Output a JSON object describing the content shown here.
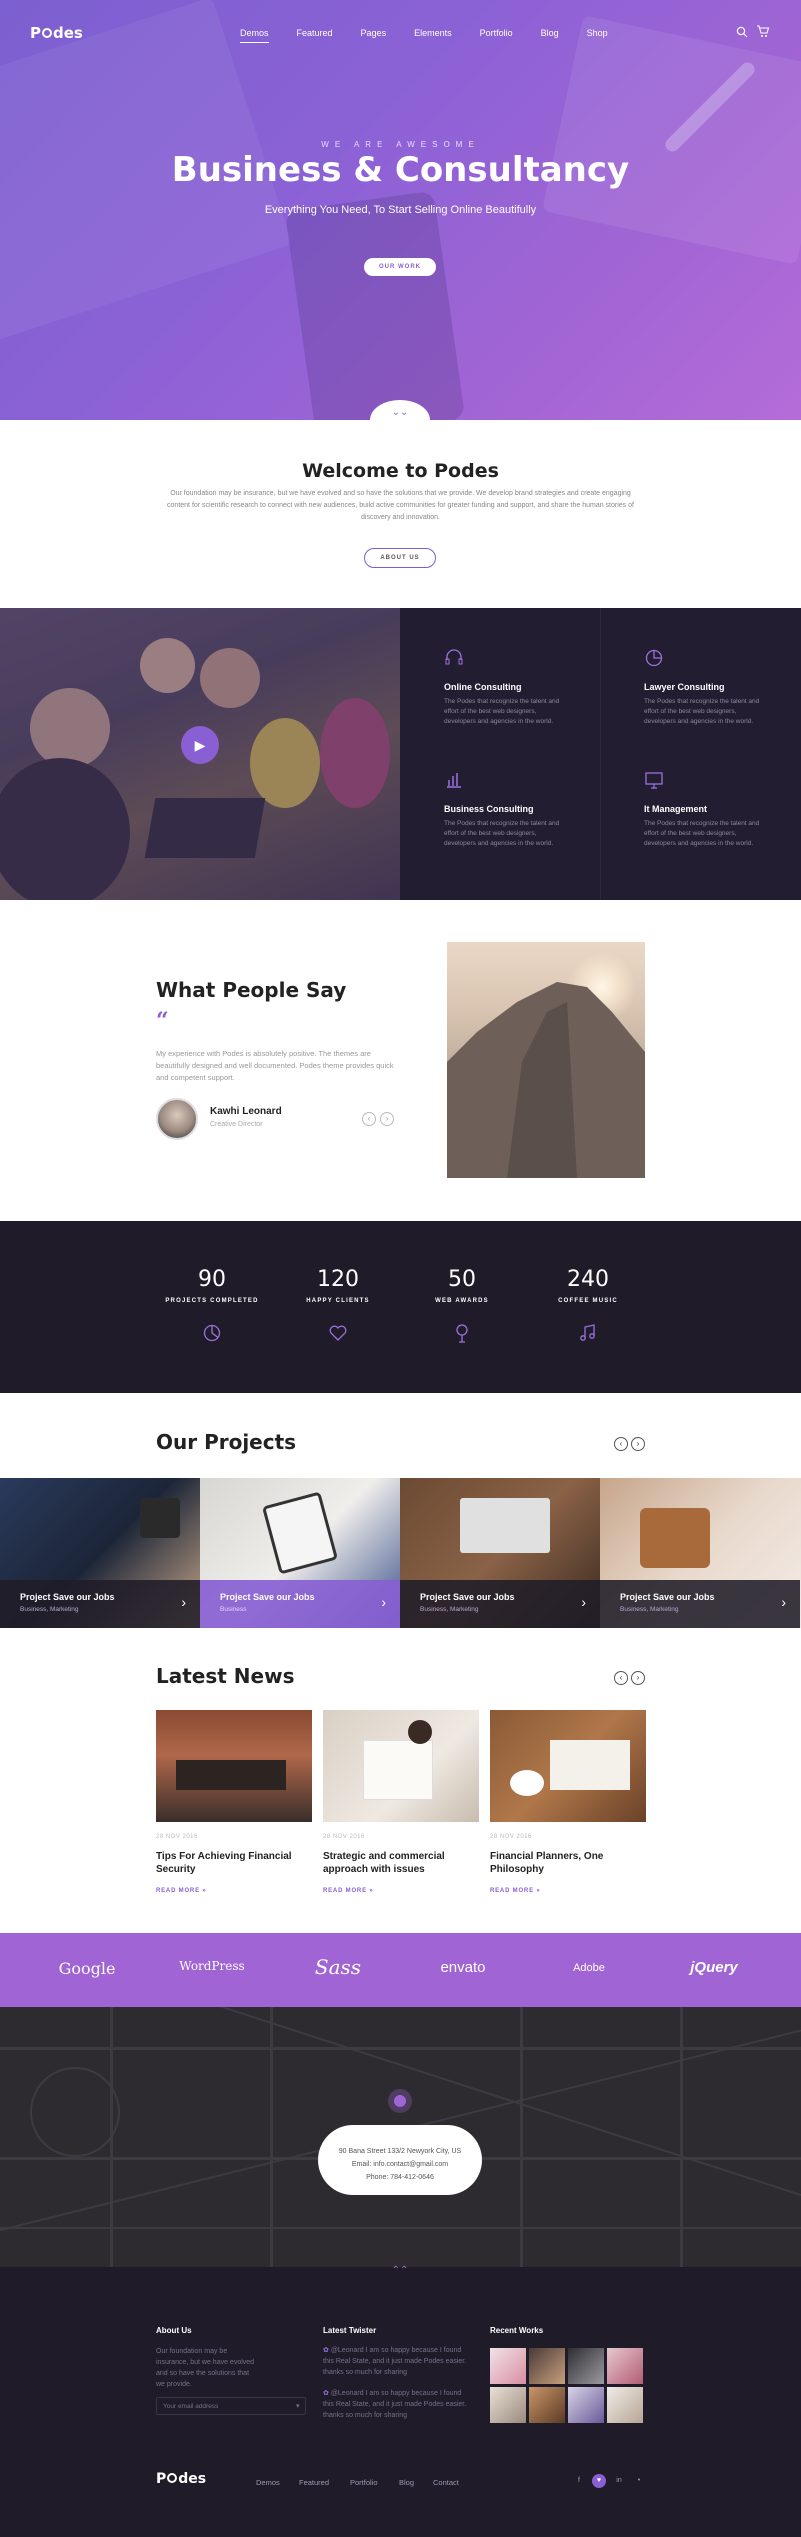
{
  "brand": {
    "logo_p": "P",
    "logo_rest": "des"
  },
  "nav": {
    "items": [
      "Demos",
      "Featured",
      "Pages",
      "Elements",
      "Portfolio",
      "Blog",
      "Shop"
    ]
  },
  "hero": {
    "pretitle": "WE ARE AWESOME",
    "title": "Business & Consultancy",
    "subtitle": "Everything You Need, To Start Selling Online Beautifully",
    "button": "OUR WORK"
  },
  "welcome": {
    "title": "Welcome to Podes",
    "text": "Our foundation may be insurance, but we have evolved and so have the solutions that we provide. We develop brand strategies and create engaging content for scientific research to connect with new audiences, build active communities for greater funding and support, and share the human stories of discovery and innovation.",
    "button": "ABOUT US"
  },
  "services": [
    {
      "icon": "headset-icon",
      "title": "Online Consulting",
      "text": "The Podes that recognize the talent and effort of the best web designers, developers and agencies in the world."
    },
    {
      "icon": "pie-chart-icon",
      "title": "Lawyer Consulting",
      "text": "The Podes that recognize the talent and effort of the best web designers, developers and agencies in the world."
    },
    {
      "icon": "bar-chart-icon",
      "title": "Business Consulting",
      "text": "The Podes that recognize the talent and effort of the best web designers, developers and agencies in the world."
    },
    {
      "icon": "monitor-icon",
      "title": "It Management",
      "text": "The Podes that recognize the talent and effort of the best web designers, developers and agencies in the world."
    }
  ],
  "testimonial": {
    "title": "What People Say",
    "quote_mark": "“",
    "text": "My experience with Podes is absolutely positive. The themes are beautifully designed and well documented. Podes theme provides quick and competent support.",
    "name": "Kawhi Leonard",
    "role": "Creative Director"
  },
  "stats": [
    {
      "value": "90",
      "label": "PROJECTS COMPLETED",
      "icon": "pie-chart-icon"
    },
    {
      "value": "120",
      "label": "HAPPY CLIENTS",
      "icon": "heart-icon"
    },
    {
      "value": "50",
      "label": "WEB AWARDS",
      "icon": "medal-icon"
    },
    {
      "value": "240",
      "label": "COFFEE MUSIC",
      "icon": "music-icon"
    }
  ],
  "projects": {
    "title": "Our Projects",
    "items": [
      {
        "title": "Project Save our Jobs",
        "sub": "Business, Marketing"
      },
      {
        "title": "Project Save our Jobs",
        "sub": "Business"
      },
      {
        "title": "Project Save our Jobs",
        "sub": "Business, Marketing"
      },
      {
        "title": "Project Save our Jobs",
        "sub": "Business, Marketing"
      }
    ]
  },
  "news": {
    "title": "Latest News",
    "items": [
      {
        "date": "28 NOV 2016",
        "title": "Tips For Achieving Financial Security",
        "more": "READ MORE »"
      },
      {
        "date": "28 NOV 2016",
        "title": "Strategic and commercial approach with issues",
        "more": "READ MORE »"
      },
      {
        "date": "28 NOV 2016",
        "title": "Financial Planners, One Philosophy",
        "more": "READ MORE »"
      }
    ]
  },
  "brands": [
    "Google",
    "WordPress",
    "Sass",
    "envato",
    "Adobe",
    "jQuery"
  ],
  "map": {
    "address": "90 Bana Street 133/2 Newyork City, US",
    "email": "Email: info.contact@gmail.com",
    "phone": "Phone: 784-412-0646"
  },
  "footer": {
    "about_title": "About Us",
    "about_text": "Our foundation may be insurance, but we have evolved and so have the solutions that we provide.",
    "email_placeholder": "Your email address",
    "twitter_title": "Latest Twister",
    "tweets": [
      "@Leonard I am so happy because I found this Real State, and it just made Podes easier. thanks so much for sharing",
      "@Leonard I am so happy because I found this Real State, and it just made Podes easier. thanks so much for sharing"
    ],
    "works_title": "Recent Works",
    "nav": [
      "Demos",
      "Featured",
      "Portfolio",
      "Blog",
      "Contact"
    ],
    "social": [
      "f",
      "♥",
      "in",
      "•"
    ]
  },
  "colors": {
    "accent": "#8a5fd3",
    "dark": "#221d30",
    "brand_strip": "#a064d4"
  }
}
